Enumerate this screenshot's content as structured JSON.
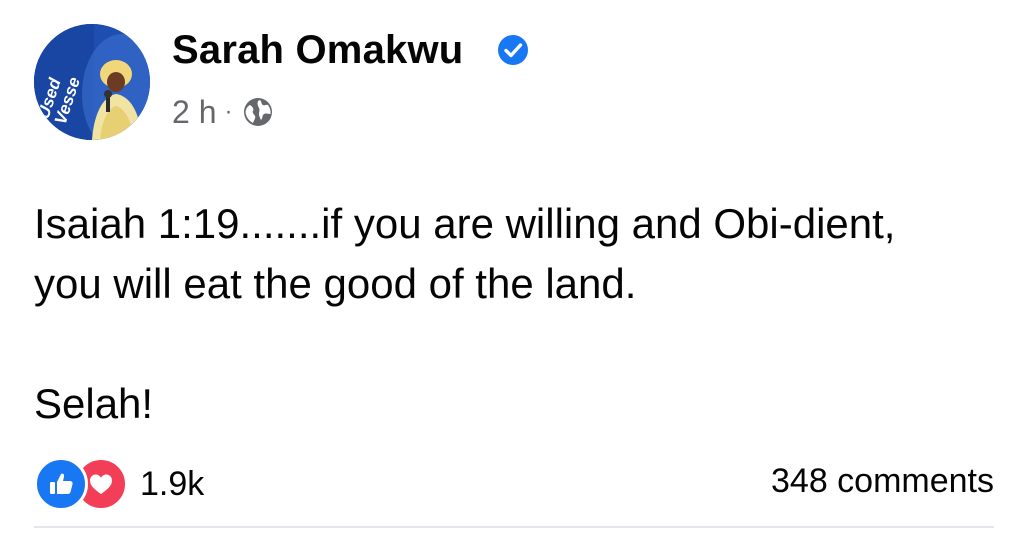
{
  "post": {
    "author": {
      "name": "Sarah Omakwu",
      "verified": true,
      "avatar_text": "Used Vessel"
    },
    "meta": {
      "time": "2 h",
      "separator": "·",
      "audience_icon": "globe-icon"
    },
    "text": {
      "line1": "Isaiah 1:19.......if you are willing and Obi-dient,",
      "line2": "you will eat the good of the land.",
      "line3": "Selah!"
    },
    "reactions": {
      "icons": [
        "like-icon",
        "love-icon"
      ],
      "count": "1.9k"
    },
    "comments": "348 comments"
  },
  "colors": {
    "like": "#1877f2",
    "love": "#f33e58",
    "verified": "#1877f2",
    "meta": "#65676b",
    "divider": "#e4e6eb"
  }
}
